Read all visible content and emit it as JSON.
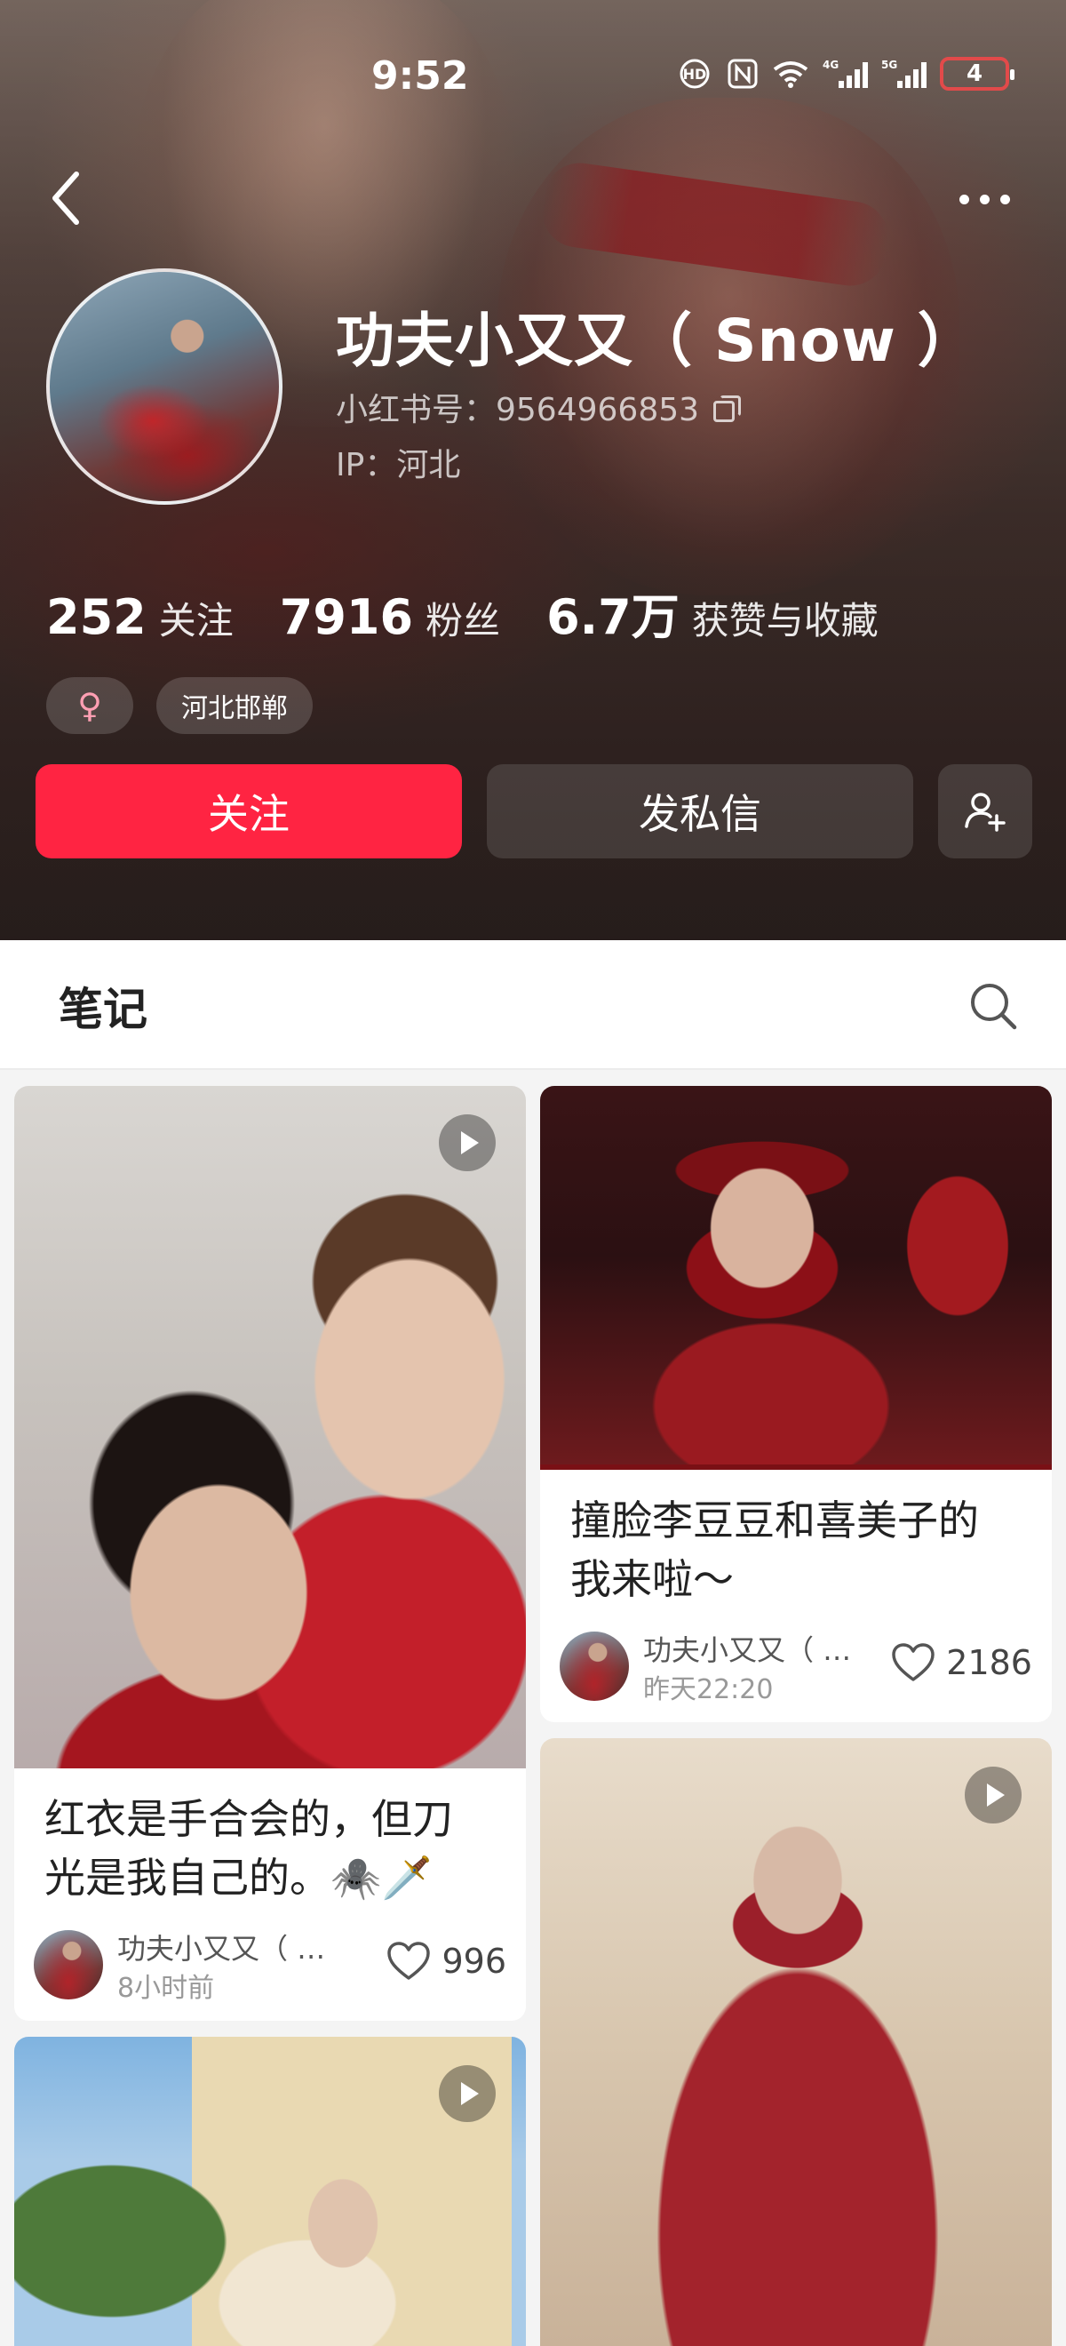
{
  "status_bar": {
    "time": "9:52",
    "icons": [
      "hd-call-icon",
      "nfc-icon",
      "wifi-icon",
      "4g-signal-icon",
      "5g-signal-icon"
    ],
    "signal_4g": "4G",
    "signal_5g": "5G",
    "battery": "4"
  },
  "profile": {
    "nickname": "功夫小又又（ Snow ）",
    "account_id": "小红书号：9564966853",
    "ip": "IP：河北",
    "stats": [
      {
        "value": "252",
        "label": "关注"
      },
      {
        "value": "7916",
        "label": "粉丝"
      },
      {
        "value": "6.7万",
        "label": "获赞与收藏"
      }
    ],
    "tags": {
      "gender": "♀",
      "location": "河北邯郸"
    },
    "actions": {
      "follow": "关注",
      "message": "发私信"
    }
  },
  "tabs": {
    "notes": "笔记"
  },
  "notes": [
    {
      "title_lines": [
        "红衣是手合会的，但刀",
        "光是我自己的。🕷️🗡️"
      ],
      "author": "功夫小又又（ …",
      "time": "8小时前",
      "likes": "996",
      "is_video": true
    },
    {
      "title_lines": [
        "撞脸李豆豆和喜美子的",
        "我来啦～"
      ],
      "author": "功夫小又又（ …",
      "time": "昨天22:20",
      "likes": "2186",
      "is_video": false
    },
    {
      "is_video": true
    },
    {
      "is_video": true
    }
  ],
  "colors": {
    "accent": "#ff2442",
    "header_bg": "#3a2a27",
    "feed_bg": "#f4f4f4"
  }
}
